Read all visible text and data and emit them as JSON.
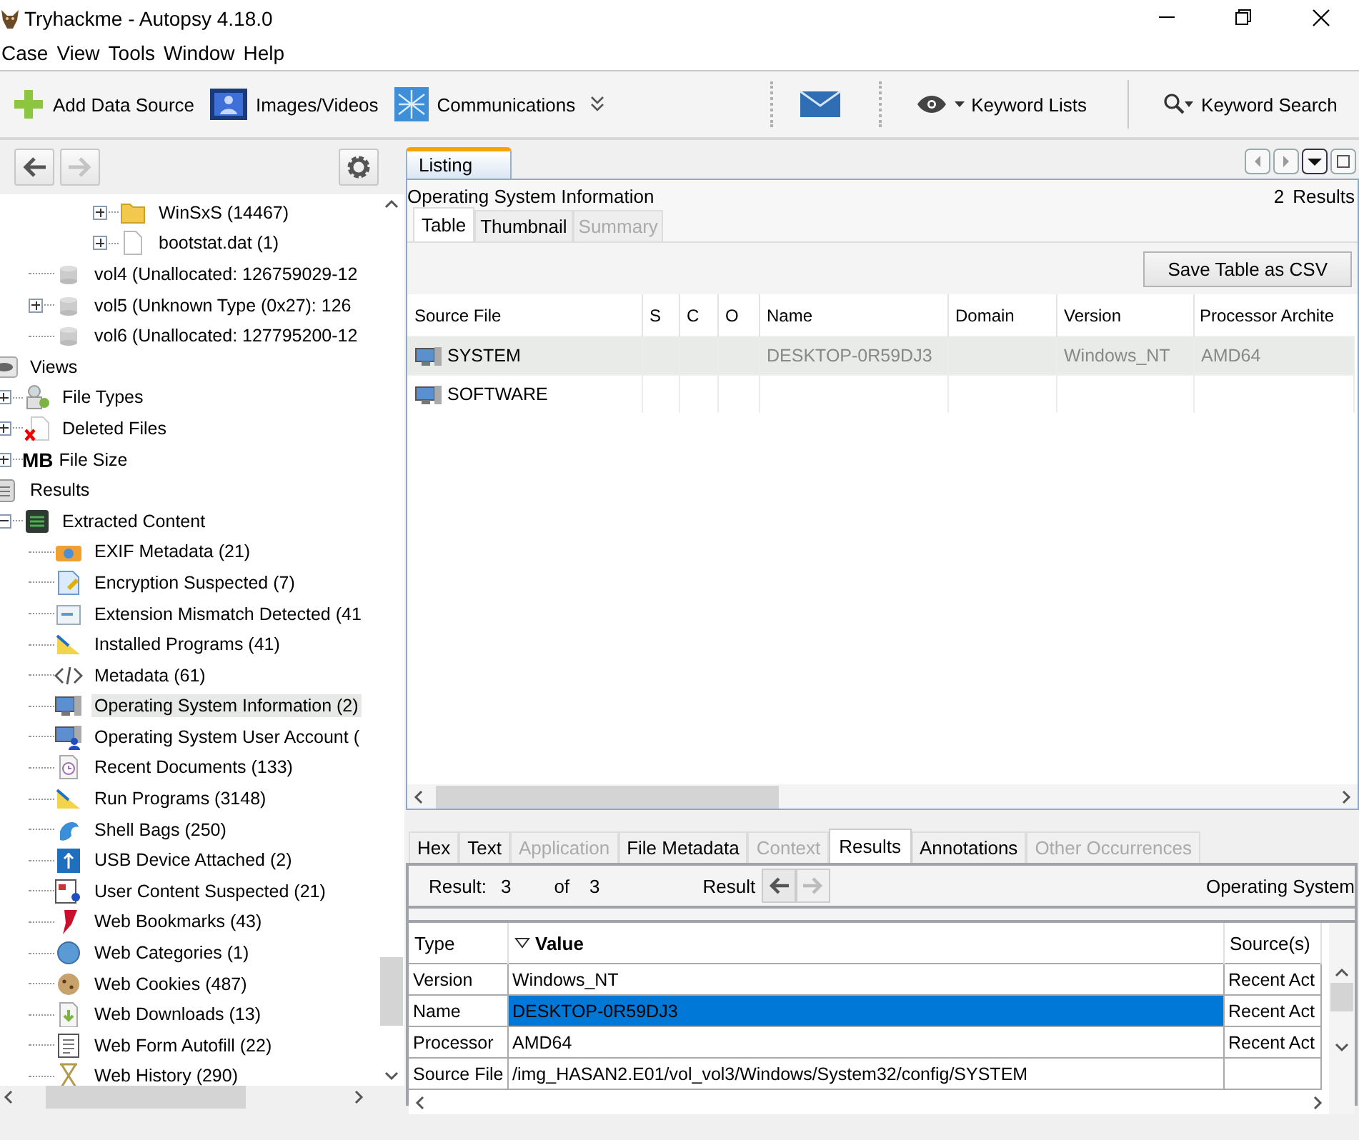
{
  "window": {
    "title": "Tryhackme - Autopsy 4.18.0"
  },
  "menu": [
    "Case",
    "View",
    "Tools",
    "Window",
    "Help"
  ],
  "toolbar": [
    {
      "kind": "add",
      "label": "Add Data Source"
    },
    {
      "kind": "images",
      "label": "Images/Videos"
    },
    {
      "kind": "communications",
      "label": "Communications"
    },
    {
      "kind": "more"
    },
    {
      "kind": "separator"
    },
    {
      "kind": "mail"
    },
    {
      "kind": "separator"
    },
    {
      "kind": "keyword-lists",
      "label": "Keyword Lists"
    },
    {
      "kind": "divider"
    },
    {
      "kind": "keyword-search",
      "label": "Keyword Search"
    }
  ],
  "nav_buttons": [
    {
      "kind": "back",
      "disabled": false
    },
    {
      "kind": "forward",
      "disabled": true
    },
    {
      "kind": "settings",
      "disabled": false
    }
  ],
  "tree": [
    {
      "children": [
        {
          "children": [
            {
              "children": [
                {
                  "children": [
                    {
                      "kind": "folder",
                      "label": "WinSxS (14467)",
                      "expanded": false,
                      "selected": false
                    },
                    {
                      "kind": "file",
                      "label": "bootstat.dat (1)",
                      "expanded": false,
                      "selected": false
                    }
                  ]
                }
              ]
            },
            {
              "kind": "volume",
              "label": "vol4 (Unallocated: 126759029-12",
              "selected": false
            },
            {
              "kind": "volume",
              "label": "vol5 (Unknown Type (0x27): 126",
              "expanded": false,
              "selected": false
            },
            {
              "kind": "volume",
              "label": "vol6 (Unallocated: 127795200-12",
              "selected": false
            }
          ]
        }
      ]
    },
    {
      "kind": "views",
      "label": "Views",
      "selected": false,
      "children": [
        {
          "kind": "filetypes",
          "label": "File Types",
          "expanded": false,
          "selected": false
        },
        {
          "kind": "deleted",
          "label": "Deleted Files",
          "expanded": false,
          "selected": false
        },
        {
          "kind": "size",
          "icon_text": "MB",
          "label": "File Size",
          "expanded": false,
          "selected": false
        }
      ]
    },
    {
      "kind": "results",
      "label": "Results",
      "selected": false,
      "children": [
        {
          "kind": "extracted",
          "label": "Extracted Content",
          "expanded": true,
          "selected": false,
          "children": [
            {
              "kind": "exif",
              "label": "EXIF Metadata (21)",
              "selected": false
            },
            {
              "kind": "encryption",
              "label": "Encryption Suspected (7)",
              "selected": false
            },
            {
              "kind": "mismatch",
              "label": "Extension Mismatch Detected (41",
              "selected": false
            },
            {
              "kind": "programs",
              "label": "Installed Programs (41)",
              "selected": false
            },
            {
              "kind": "metadata",
              "label": "Metadata (61)",
              "selected": false
            },
            {
              "kind": "os",
              "label": "Operating System Information (2)",
              "selected": true
            },
            {
              "kind": "osuser",
              "label": "Operating System User Account (",
              "selected": false
            },
            {
              "kind": "recent",
              "label": "Recent Documents (133)",
              "selected": false
            },
            {
              "kind": "programs",
              "label": "Run Programs (3148)",
              "selected": false
            },
            {
              "kind": "shellbags",
              "label": "Shell Bags (250)",
              "selected": false
            },
            {
              "kind": "usb",
              "label": "USB Device Attached (2)",
              "selected": false
            },
            {
              "kind": "usercontent",
              "label": "User Content Suspected (21)",
              "selected": false
            },
            {
              "kind": "bookmark",
              "label": "Web Bookmarks (43)",
              "selected": false
            },
            {
              "kind": "category",
              "label": "Web Categories (1)",
              "selected": false
            },
            {
              "kind": "cookie",
              "label": "Web Cookies (487)",
              "selected": false
            },
            {
              "kind": "download",
              "label": "Web Downloads (13)",
              "selected": false
            },
            {
              "kind": "autofill",
              "label": "Web Form Autofill (22)",
              "selected": false
            },
            {
              "kind": "history",
              "label": "Web History (290)",
              "selected": false
            }
          ]
        }
      ]
    }
  ],
  "listing": {
    "tab": "Listing",
    "title": "Operating System Information",
    "count": "2",
    "count_label": "Results",
    "view_tabs": [
      {
        "label": "Table",
        "selected": true,
        "disabled": false
      },
      {
        "label": "Thumbnail",
        "selected": false,
        "disabled": false
      },
      {
        "label": "Summary",
        "selected": false,
        "disabled": true
      }
    ],
    "save_button": "Save Table as CSV",
    "columns": [
      "Source File",
      "S",
      "C",
      "O",
      "Name",
      "Domain",
      "Version",
      "Processor Archite"
    ],
    "rows": [
      {
        "selected": true,
        "source_file": "SYSTEM",
        "name": "DESKTOP-0R59DJ3",
        "version": "Windows_NT",
        "processor": "AMD64"
      },
      {
        "selected": false,
        "source_file": "SOFTWARE"
      }
    ]
  },
  "viewer": {
    "tabs": [
      {
        "label": "Hex",
        "selected": false,
        "disabled": false
      },
      {
        "label": "Text",
        "selected": false,
        "disabled": false
      },
      {
        "label": "Application",
        "selected": false,
        "disabled": true
      },
      {
        "label": "File Metadata",
        "selected": false,
        "disabled": false
      },
      {
        "label": "Context",
        "selected": false,
        "disabled": true
      },
      {
        "label": "Results",
        "selected": true,
        "disabled": false
      },
      {
        "label": "Annotations",
        "selected": false,
        "disabled": false
      },
      {
        "label": "Other Occurrences",
        "selected": false,
        "disabled": true
      }
    ],
    "result_label": "Result:",
    "result_index": "3",
    "of_label": "of",
    "result_total": "3",
    "nav_label": "Result",
    "artifact": "Operating System",
    "columns": [
      {
        "label": "Type",
        "sorted": false
      },
      {
        "label": "Value",
        "sorted": true
      },
      {
        "label": "Source(s)",
        "sorted": false
      }
    ],
    "rows": [
      {
        "type": "Version",
        "value": "Windows_NT",
        "source": "Recent Act",
        "selected": false
      },
      {
        "type": "Name",
        "value": "DESKTOP-0R59DJ3",
        "source": "Recent Act",
        "selected": true
      },
      {
        "type": "Processor",
        "value": "AMD64",
        "source": "Recent Act",
        "selected": false
      },
      {
        "type": "Source File",
        "value": "/img_HASAN2.E01/vol_vol3/Windows/System32/config/SYSTEM",
        "selected": false
      }
    ]
  }
}
